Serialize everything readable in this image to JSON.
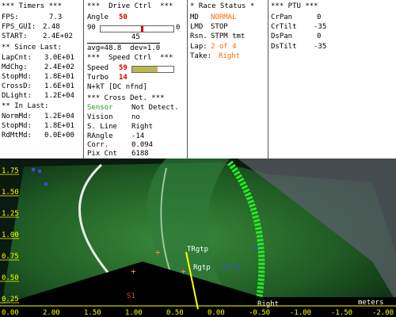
{
  "timers": {
    "title": "*** Timers ***",
    "rows": [
      {
        "label": "FPS:",
        "value": "7.3"
      },
      {
        "label": "FPS_GUI:",
        "value": "2.48"
      },
      {
        "label": "START:",
        "value": "2.4E+02"
      }
    ],
    "since_title": "** Since Last:",
    "since_rows": [
      {
        "label": "LapCnt:",
        "value": "3.0E+01"
      },
      {
        "label": "MdChg:",
        "value": "2.4E+02"
      },
      {
        "label": "StopMd:",
        "value": "1.8E+01"
      },
      {
        "label": "CrossD:",
        "value": "1.6E+01"
      },
      {
        "label": "DLight:",
        "value": "1.2E+04"
      }
    ],
    "in_title": "** In Last:",
    "in_rows": [
      {
        "label": "NormMd:",
        "value": "1.2E+04"
      },
      {
        "label": "StopMd:",
        "value": "1.8E+01"
      },
      {
        "label": "RdMtMd:",
        "value": "0.0E+00"
      }
    ]
  },
  "drive": {
    "title": "***  Drive Ctrl  ***",
    "angle_label": "Angle",
    "angle_value": "50",
    "angle_min": "90",
    "angle_max": "0",
    "angle_mid": "45",
    "angle_fraction": 0.55,
    "avg_text": "avg=48.8  dev=1.0",
    "speed_title": "***  Speed Ctrl  ***",
    "speed_label": "Speed",
    "speed_value": "59",
    "speed_fraction": 0.62,
    "turbo_label": "Turbo",
    "turbo_value": "14",
    "nkt_text": "N+kT [DC nfnd]",
    "cross_title": "*** Cross Det. ***",
    "cross_rows": [
      {
        "label": "Sensor",
        "value": "Not Detect."
      },
      {
        "label": "Vision",
        "value": "no"
      },
      {
        "label": "S. Line",
        "value": "Right"
      },
      {
        "label": "RAngle",
        "value": "-14"
      },
      {
        "label": "Corr.",
        "value": "0.094"
      },
      {
        "label": "Pix Cnt",
        "value": "6188"
      }
    ]
  },
  "race": {
    "title": "* Race Status *",
    "rows": [
      {
        "label": "MD",
        "value": "NORMAL"
      },
      {
        "label": "LMD",
        "value": "STOP"
      },
      {
        "label": "Rsn.",
        "value": "STPM tmt"
      },
      {
        "label": "Lap:",
        "value": "2 of 4"
      },
      {
        "label": "Take:",
        "value": "Right"
      }
    ]
  },
  "ptu": {
    "title": "*** PTU ***",
    "rows": [
      {
        "label": "CrPan",
        "value": "0"
      },
      {
        "label": "CrTilt",
        "value": "-35"
      },
      {
        "label": "DsPan",
        "value": "0"
      },
      {
        "label": "DsTilt",
        "value": "-35"
      }
    ]
  },
  "view": {
    "y_ticks": [
      "1.75",
      "1.50",
      "1.25",
      "1.00",
      "0.75",
      "0.50",
      "0.25"
    ],
    "x_ticks": [
      "0.00",
      "2.00",
      "1.50",
      "1.00",
      "0.50",
      "0.00",
      "-0.50",
      "-1.00",
      "-1.50",
      "-2.00"
    ],
    "unit_label": "meters",
    "markers": {
      "trgtp": "TRgtp",
      "rgtp": "Rgtp",
      "right": "Right",
      "lft": "Lft",
      "s1": "S1"
    }
  },
  "colors": {
    "green": "#1e9a1e",
    "orange": "#ff6a00",
    "red": "#d40000",
    "lane": "#22dd22",
    "yellow": "#ffff00"
  }
}
